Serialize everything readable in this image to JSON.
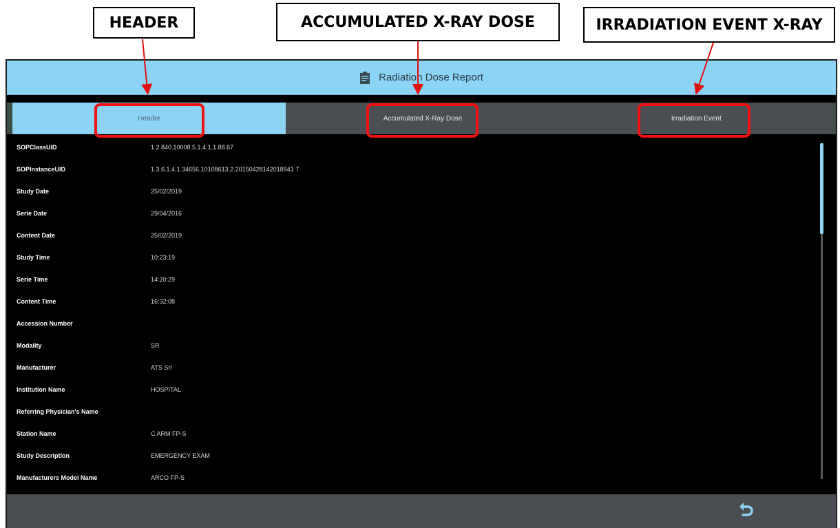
{
  "callouts": {
    "header": "HEADER",
    "accumulated": "ACCUMULATED X-RAY DOSE",
    "irradiation": "IRRADIATION EVENT X-RAY"
  },
  "window": {
    "title": "Radiation Dose Report",
    "title_icon": "report-clipboard-icon"
  },
  "tabs": [
    {
      "label": "Header",
      "active": true
    },
    {
      "label": "Accumulated X-Ray Dose",
      "active": false
    },
    {
      "label": "Irradiation Event",
      "active": false
    }
  ],
  "rows": [
    {
      "label": "SOPClassUID",
      "value": "1.2.840.10008.5.1.4.1.1.88.67"
    },
    {
      "label": "SOPInstanceUID",
      "value": "1.3.6.1.4.1.34656.10108613.2.20150428142018941 7"
    },
    {
      "label": "Study Date",
      "value": "25/02/2019"
    },
    {
      "label": "Serie Date",
      "value": "29/04/2016"
    },
    {
      "label": "Content Date",
      "value": "25/02/2019"
    },
    {
      "label": "Study Time",
      "value": "10:23:19"
    },
    {
      "label": "Serie Time",
      "value": "14:20:29"
    },
    {
      "label": "Content Time",
      "value": "16:32:08"
    },
    {
      "label": "Accession Number",
      "value": ""
    },
    {
      "label": "Modality",
      "value": "SR"
    },
    {
      "label": "Manufacturer",
      "value": "ATS Srl"
    },
    {
      "label": "Institution Name",
      "value": "HOSPITAL"
    },
    {
      "label": "Referring Physician's Name",
      "value": ""
    },
    {
      "label": "Station Name",
      "value": "C ARM FP-S"
    },
    {
      "label": "Study Description",
      "value": "EMERGENCY EXAM"
    },
    {
      "label": "Manufacturers Model Name",
      "value": "ARCO FP-S"
    }
  ],
  "footer": {
    "back_icon": "undo-arrow-icon"
  },
  "colors": {
    "accent": "#8dd3f6",
    "highlight": "#ef1010",
    "panel": "#4a4d52",
    "background": "#000000"
  }
}
